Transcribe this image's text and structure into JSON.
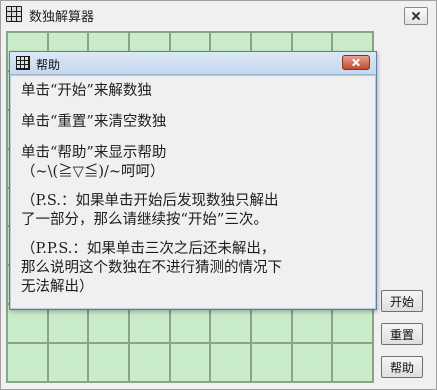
{
  "main_window": {
    "title": "数独解算器"
  },
  "buttons": {
    "start": "开始",
    "reset": "重置",
    "help": "帮助"
  },
  "help_dialog": {
    "title": "帮助",
    "lines": [
      "单击“开始”来解数独",
      "单击“重置”来清空数独",
      "单击“帮助”来显示帮助",
      "（~\\(≧▽≦)/~呵呵）",
      "（P.S.：如果单击开始后发现数独只解出",
      "了一部分，那么请继续按“开始”三次。",
      "（P.P.S.：如果单击三次之后还未解出，",
      "那么说明这个数独在不进行猜测的情况下",
      "无法解出）"
    ]
  },
  "colors": {
    "cell_fill": "#c9ecc9",
    "grid_line": "#8aa38a",
    "dialog_close": "#c24a32"
  }
}
